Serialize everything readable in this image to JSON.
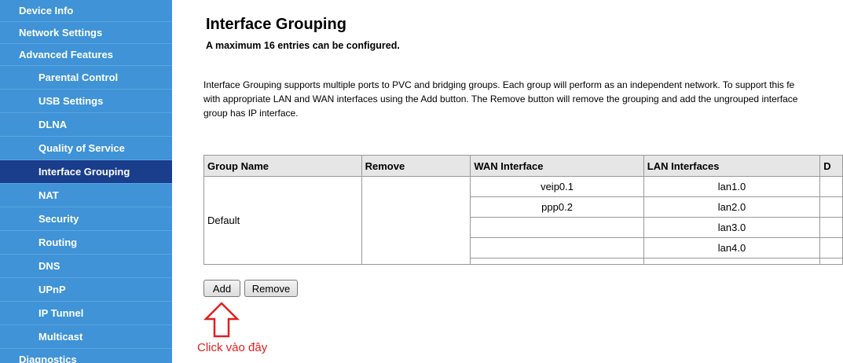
{
  "sidebar": {
    "items": [
      {
        "label": "Device Info"
      },
      {
        "label": "Network Settings"
      },
      {
        "label": "Advanced Features"
      },
      {
        "label": "Parental Control"
      },
      {
        "label": "USB Settings"
      },
      {
        "label": "DLNA"
      },
      {
        "label": "Quality of Service"
      },
      {
        "label": "Interface Grouping"
      },
      {
        "label": "NAT"
      },
      {
        "label": "Security"
      },
      {
        "label": "Routing"
      },
      {
        "label": "DNS"
      },
      {
        "label": "UPnP"
      },
      {
        "label": "IP Tunnel"
      },
      {
        "label": "Multicast"
      },
      {
        "label": "Diagnostics"
      }
    ],
    "active": "Interface Grouping",
    "colors": {
      "background": "#3f93d6",
      "active": "#1a3d8c"
    }
  },
  "main": {
    "title": "Interface Grouping",
    "subtitle": "A maximum 16 entries can be configured.",
    "description": [
      "Interface Grouping supports multiple ports to PVC and bridging groups. Each group will perform as an independent network. To support this fe",
      "with appropriate LAN and WAN interfaces using the Add button. The Remove button will remove the grouping and add the ungrouped interface",
      "group has IP interface."
    ],
    "table": {
      "headers": [
        "Group Name",
        "Remove",
        "WAN Interface",
        "LAN Interfaces",
        "D"
      ],
      "group_name": "Default",
      "wan": [
        "veip0.1",
        "ppp0.2",
        "",
        ""
      ],
      "lan": [
        "lan1.0",
        "lan2.0",
        "lan3.0",
        "lan4.0"
      ]
    },
    "buttons": {
      "add": "Add",
      "remove": "Remove"
    },
    "annotation": {
      "note": "Click vào đây",
      "arrow_icon": "up-arrow-icon",
      "color": "#e02020"
    }
  }
}
